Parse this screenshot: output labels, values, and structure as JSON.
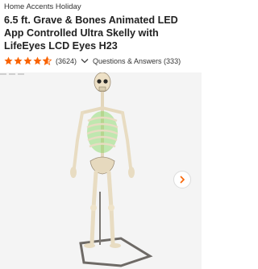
{
  "product": {
    "brand": "Home Accents Holiday",
    "title": "6.5 ft. Grave & Bones Animated LED App Controlled Ultra Skelly with LifeEyes LCD Eyes H23"
  },
  "rating": {
    "stars": 4.6,
    "review_count": "(3624)",
    "qa_label": "Questions & Answers (333)"
  },
  "icons": {
    "star": "star-icon",
    "chevron": "chevron-down-icon",
    "next": "chevron-right-icon"
  },
  "colors": {
    "star": "#f96302",
    "accent": "#f96302",
    "panel": "#f4f4f4"
  }
}
